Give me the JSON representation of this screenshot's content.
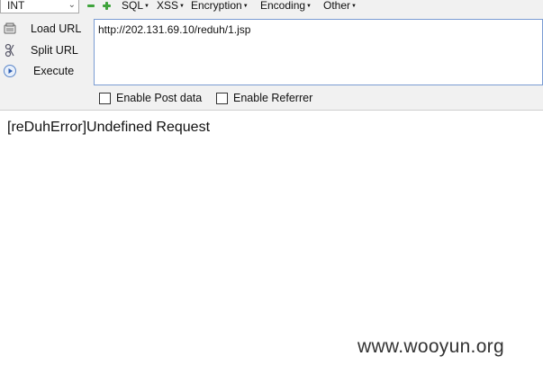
{
  "toolbar": {
    "type_select": {
      "value": "INT"
    },
    "menus": [
      {
        "label": "SQL"
      },
      {
        "label": "XSS"
      },
      {
        "label": "Encryption"
      },
      {
        "label": "Encoding"
      },
      {
        "label": "Other"
      }
    ],
    "actions": {
      "load_url": "Load URL",
      "split_url": "Split URL",
      "execute": "Execute"
    },
    "url_value": "http://202.131.69.10/reduh/1.jsp",
    "options": {
      "post_data": {
        "label": "Enable Post data",
        "checked": false
      },
      "referrer": {
        "label": "Enable Referrer",
        "checked": false
      }
    }
  },
  "content": {
    "response_text": "[reDuhError]Undefined Request"
  },
  "watermark": "www.wooyun.org",
  "colors": {
    "accent_green": "#3fa33c",
    "url_border": "#7a9cd3",
    "toolbar_bg": "#f1f1f1"
  },
  "icons": {
    "minus": "minus-icon",
    "plus": "plus-icon",
    "load": "load-url-icon",
    "split": "split-url-icon",
    "execute": "execute-play-icon"
  }
}
